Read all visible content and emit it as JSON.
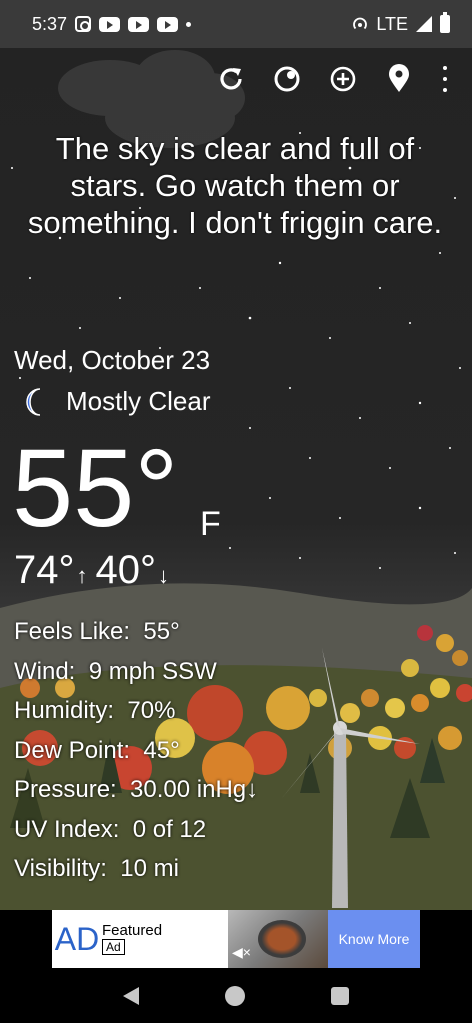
{
  "status_bar": {
    "time": "5:37",
    "network": "LTE",
    "icons": [
      "instagram-icon",
      "youtube-icon",
      "youtube-icon",
      "youtube-icon",
      "notification-dot-icon",
      "hotspot-icon",
      "signal-icon",
      "battery-icon"
    ]
  },
  "toolbar": {
    "buttons": [
      "refresh-icon",
      "theme-icon",
      "add-location-icon",
      "location-pin-icon",
      "more-icon"
    ]
  },
  "weather": {
    "quip": "The sky is clear and full of stars. Go watch them or something. I don't friggin care.",
    "date": "Wed, October 23",
    "condition": "Mostly Clear",
    "condition_icon": "crescent-moon-icon",
    "temperature": "55°",
    "unit": "F",
    "high": "74°",
    "high_arrow": "↑",
    "low": "40°",
    "low_arrow": "↓"
  },
  "details": [
    {
      "label": "Feels Like:",
      "value": "55°"
    },
    {
      "label": "Wind:",
      "value": "9 mph SSW"
    },
    {
      "label": "Humidity:",
      "value": "70%"
    },
    {
      "label": "Dew Point:",
      "value": "45°"
    },
    {
      "label": "Pressure:",
      "value": "30.00 inHg↓"
    },
    {
      "label": "UV Index:",
      "value": "0 of 12"
    },
    {
      "label": "Visibility:",
      "value": "10 mi"
    }
  ],
  "ad": {
    "logo": "AD",
    "title": "Featured",
    "tag": "Ad",
    "cta": "Know More"
  },
  "colors": {
    "status_bar": "#3a3a3a",
    "ad_logo": "#2b63c9",
    "ad_button": "#6b8ff0",
    "moon": "#3f6fe0"
  }
}
